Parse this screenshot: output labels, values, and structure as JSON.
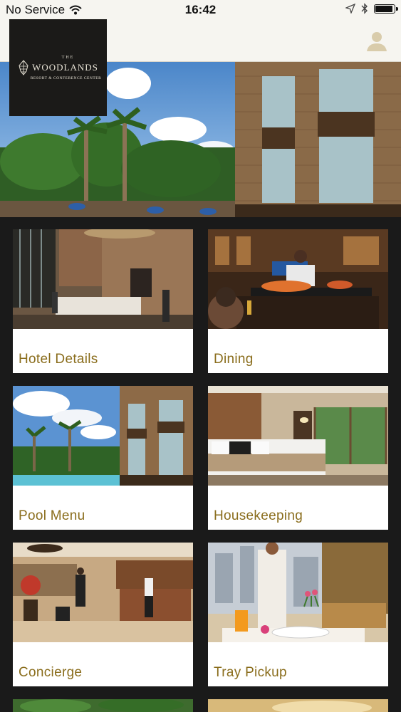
{
  "status_bar": {
    "carrier": "No Service",
    "time": "16:42",
    "battery_level": 0.85
  },
  "brand": {
    "logo_the": "THE",
    "logo_name": "WOODLANDS",
    "logo_sub": "RESORT & CONFERENCE CENTER"
  },
  "header": {
    "profile_icon": "user-icon"
  },
  "colors": {
    "label": "#8a6d1c",
    "background": "#1a1a1a",
    "header": "#f6f5f0"
  },
  "tiles": [
    {
      "label": "Hotel Details",
      "icon": "lobby-photo"
    },
    {
      "label": "Dining",
      "icon": "dining-photo"
    },
    {
      "label": "Pool Menu",
      "icon": "pool-photo"
    },
    {
      "label": "Housekeeping",
      "icon": "bedroom-photo"
    },
    {
      "label": "Concierge",
      "icon": "reception-photo"
    },
    {
      "label": "Tray Pickup",
      "icon": "room-service-photo"
    }
  ]
}
